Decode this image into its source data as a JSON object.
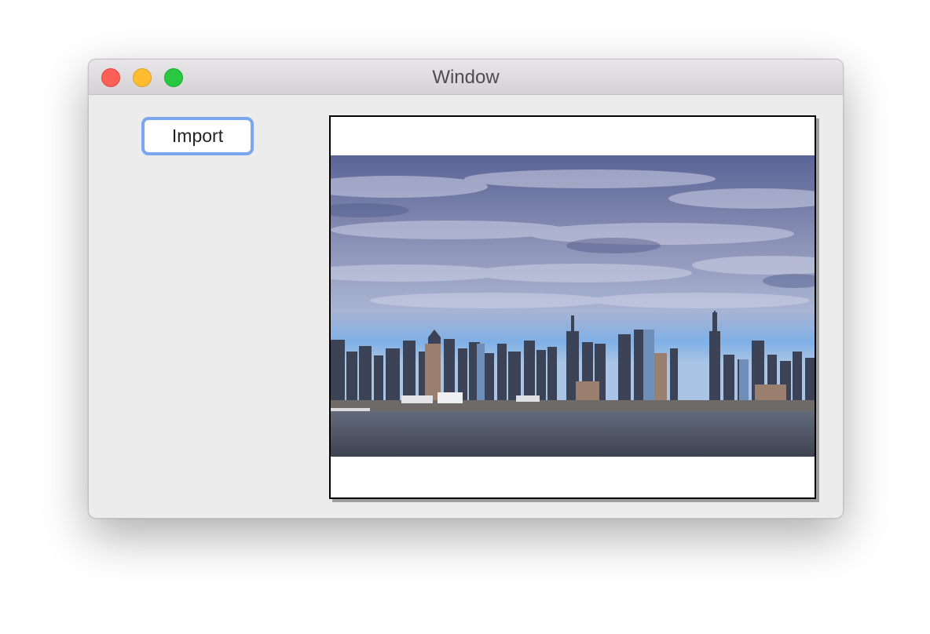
{
  "window": {
    "title": "Window",
    "controls": [
      "close-button",
      "minimize-button",
      "zoom-button"
    ]
  },
  "toolbar": {
    "import_label": "Import"
  },
  "image_view": {
    "content": "city-skyline-photo"
  }
}
